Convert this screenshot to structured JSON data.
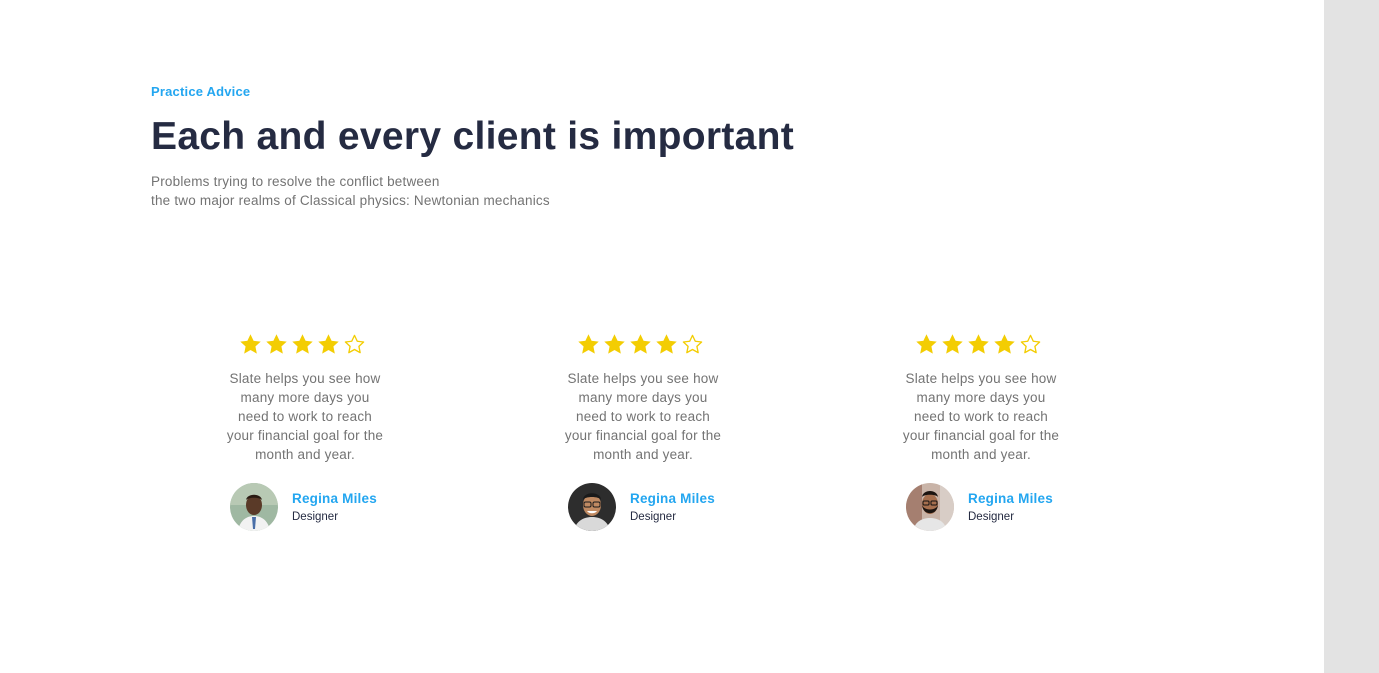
{
  "section": {
    "eyebrow": "Practice Advice",
    "title": "Each and every client is important",
    "subtitle_line1": "Problems trying to resolve the conflict between",
    "subtitle_line2": "the two major realms of Classical physics: Newtonian mechanics"
  },
  "testimonials": [
    {
      "rating": 4,
      "max_rating": 5,
      "quote": "Slate helps you see how many more days you need to work to reach your financial goal for the month and year.",
      "name": "Regina Miles",
      "role": "Designer"
    },
    {
      "rating": 4,
      "max_rating": 5,
      "quote": "Slate helps you see how many more days you need to work to reach your financial goal for the month and year.",
      "name": "Regina Miles",
      "role": "Designer"
    },
    {
      "rating": 4,
      "max_rating": 5,
      "quote": "Slate helps you see how many more days you need to work to reach your financial goal for the month and year.",
      "name": "Regina Miles",
      "role": "Designer"
    }
  ],
  "colors": {
    "accent": "#23a6f0",
    "heading": "#252b42",
    "body_text": "#737373",
    "star": "#f3cd03"
  },
  "icons": {
    "filled_star": "star-filled-icon",
    "empty_star": "star-outline-icon"
  }
}
